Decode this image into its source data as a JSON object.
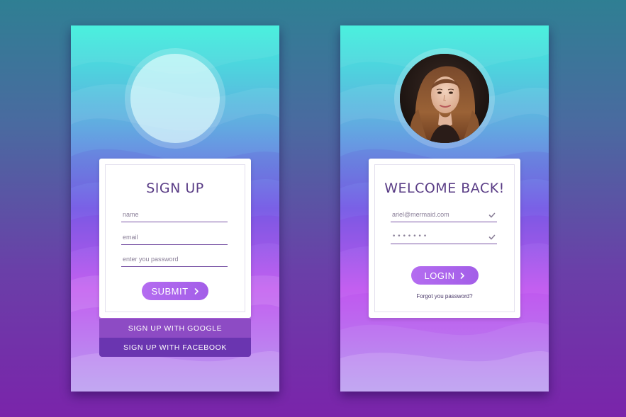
{
  "signup_screen": {
    "title": "SIGN UP",
    "fields": [
      {
        "label": "name"
      },
      {
        "label": "email"
      },
      {
        "label": "enter you password"
      }
    ],
    "submit_label": "SUBMIT",
    "google_label": "SIGN UP WITH GOOGLE",
    "facebook_label": "SIGN UP WITH FACEBOOK"
  },
  "login_screen": {
    "title": "WELCOME BACK!",
    "email_value": "ariel@mermaid.com",
    "password_mask": "•••••••",
    "login_label": "LOGIN",
    "forgot_label": "Forgot you password?"
  },
  "icons": {
    "submit_chevron": "chevron-right-icon",
    "login_chevron": "chevron-right-icon",
    "email_check": "check-icon",
    "password_check": "check-icon"
  },
  "colors": {
    "accent": "#a35ee8",
    "title": "#5a3d86",
    "google": "#8d4bc4",
    "facebook": "#6a35b0"
  }
}
